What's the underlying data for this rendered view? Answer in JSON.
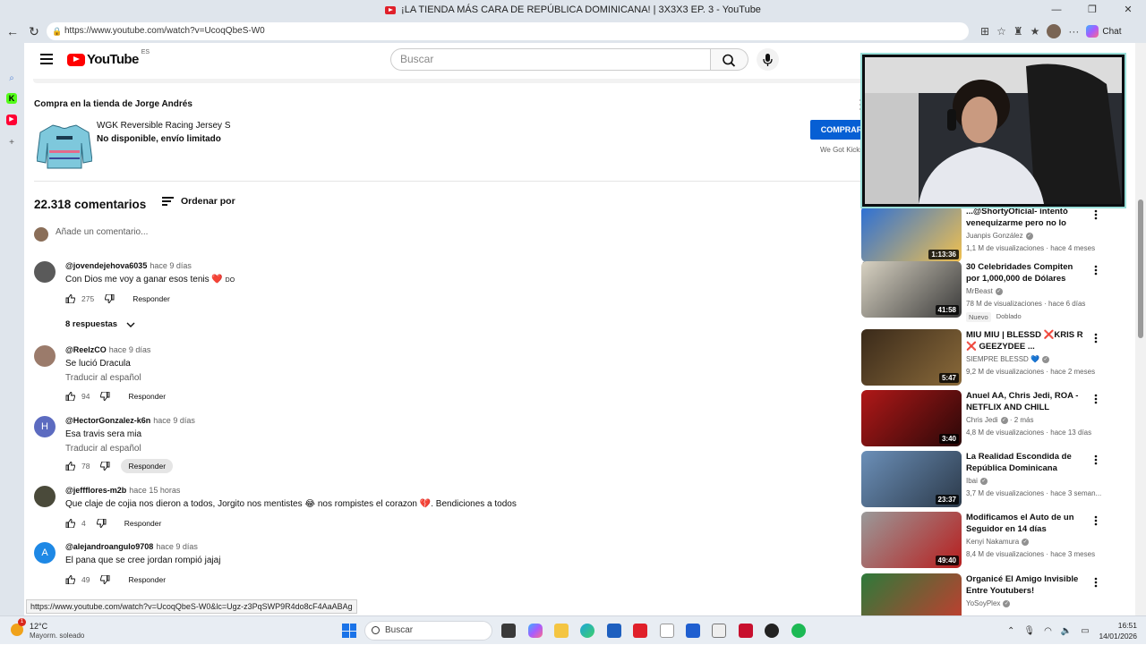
{
  "browser": {
    "window_title": "¡LA TIENDA MÁS CARA DE REPÚBLICA DOMINICANA! | 3X3X3 EP. 3 - YouTube",
    "url": "https://www.youtube.com/watch?v=UcoqQbeS-W0",
    "chat_label": "Chat",
    "status_url": "https://www.youtube.com/watch?v=UcoqQbeS-W0&lc=Ugz-z3PqSWP9R4do8cF4AaABAg"
  },
  "header": {
    "logo_text": "YouTube",
    "country_code": "ES",
    "search_placeholder": "Buscar"
  },
  "shop": {
    "title": "Compra en la tienda de Jorge Andrés",
    "product_name": "WGK Reversible Racing Jersey S",
    "product_status": "No disponible, envío limitado",
    "buy_label": "COMPRAR",
    "store_name": "We Got Kicks"
  },
  "comments_section": {
    "count_label": "22.318 comentarios",
    "sort_label": "Ordenar por",
    "add_placeholder": "Añade un comentario...",
    "replies_toggle": "8 respuestas",
    "reply_label": "Responder",
    "translate_label": "Traducir al español",
    "comments": [
      {
        "handle": "@jovendejehova6035",
        "ago": "hace 9 días",
        "text": "Con Dios me voy a ganar esos tenis ❤️",
        "text_suffix": "DO",
        "likes": "275",
        "avatar_letter": "",
        "avatar_color": "#5a5a5a"
      },
      {
        "handle": "@ReelzCO",
        "ago": "hace 9 días",
        "text": "Se lució Dracula",
        "likes": "94",
        "avatar_letter": "",
        "avatar_color": "#9b7b6b"
      },
      {
        "handle": "@HectorGonzalez-k6n",
        "ago": "hace 9 días",
        "text": "Esa travis sera mia",
        "likes": "78",
        "avatar_letter": "H",
        "avatar_color": "#5c6bc0"
      },
      {
        "handle": "@jeffflores-m2b",
        "ago": "hace 15 horas",
        "text": "Que claje de cojia nos dieron a todos, Jorgito nos mentistes 😂 nos rompistes el corazon 💔. Bendiciones a todos",
        "likes": "4",
        "avatar_letter": "",
        "avatar_color": "#4a4a3a"
      },
      {
        "handle": "@alejandroangulo9708",
        "ago": "hace 9 días",
        "text": "El pana que se cree jordan rompió jajaj",
        "likes": "49",
        "avatar_letter": "A",
        "avatar_color": "#1e88e5"
      }
    ]
  },
  "sidebar": {
    "videos": [
      {
        "title": "...@ShortyOficial- intentó venequizarme pero no lo logró...",
        "channel": "Juanpis González",
        "verified": true,
        "meta": "1,1 M de visualizaciones · hace 4 meses",
        "duration": "1:13:36",
        "colors": [
          "#2b6fd6",
          "#f2c14e"
        ]
      },
      {
        "title": "30 Celebridades Compiten por 1,000,000 de Dólares",
        "channel": "MrBeast",
        "verified": true,
        "meta": "78 M de visualizaciones · hace 6 días",
        "duration": "41:58",
        "badges": [
          "Nuevo",
          "Doblado"
        ],
        "colors": [
          "#d8d2c2",
          "#3a3a3a"
        ]
      },
      {
        "title": "MIU MIU | BLESSD ❌KRIS R ❌ GEEZYDEE ...",
        "channel": "SIEMPRE BLESSD 💙",
        "verified": true,
        "meta": "9,2 M de visualizaciones · hace 2 meses",
        "duration": "5:47",
        "colors": [
          "#3a2a1a",
          "#8a6a3a"
        ]
      },
      {
        "title": "Anuel AA, Chris Jedi, ROA - NETFLIX AND CHILL",
        "channel": "Chris Jedi",
        "verified": true,
        "channel_extra": "· 2 más",
        "meta": "4,8 M de visualizaciones · hace 13 días",
        "duration": "3:40",
        "colors": [
          "#b01818",
          "#2a0808"
        ]
      },
      {
        "title": "La Realidad Escondida de República Dominicana",
        "channel": "Ibai",
        "verified": true,
        "meta": "3,7 M de visualizaciones · hace 3 seman...",
        "duration": "23:37",
        "colors": [
          "#6b8fb8",
          "#2c3a4a"
        ]
      },
      {
        "title": "Modificamos el Auto de un Seguidor en 14 días",
        "channel": "Kenyi Nakamura",
        "verified": true,
        "meta": "8,4 M de visualizaciones · hace 3 meses",
        "duration": "49:40",
        "colors": [
          "#9a9a9a",
          "#b81d1d"
        ]
      },
      {
        "title": "Organicé El Amigo Invisible Entre Youtubers!",
        "channel": "YoSoyPlex",
        "verified": true,
        "meta": "",
        "duration": "",
        "colors": [
          "#2d7a3a",
          "#c93b2f"
        ]
      }
    ]
  },
  "taskbar": {
    "temperature": "12°C",
    "weather_condition": "Mayorm. soleado",
    "weather_badge": "1",
    "search_label": "Buscar",
    "time": "16:51",
    "date": "14/01/2026"
  }
}
